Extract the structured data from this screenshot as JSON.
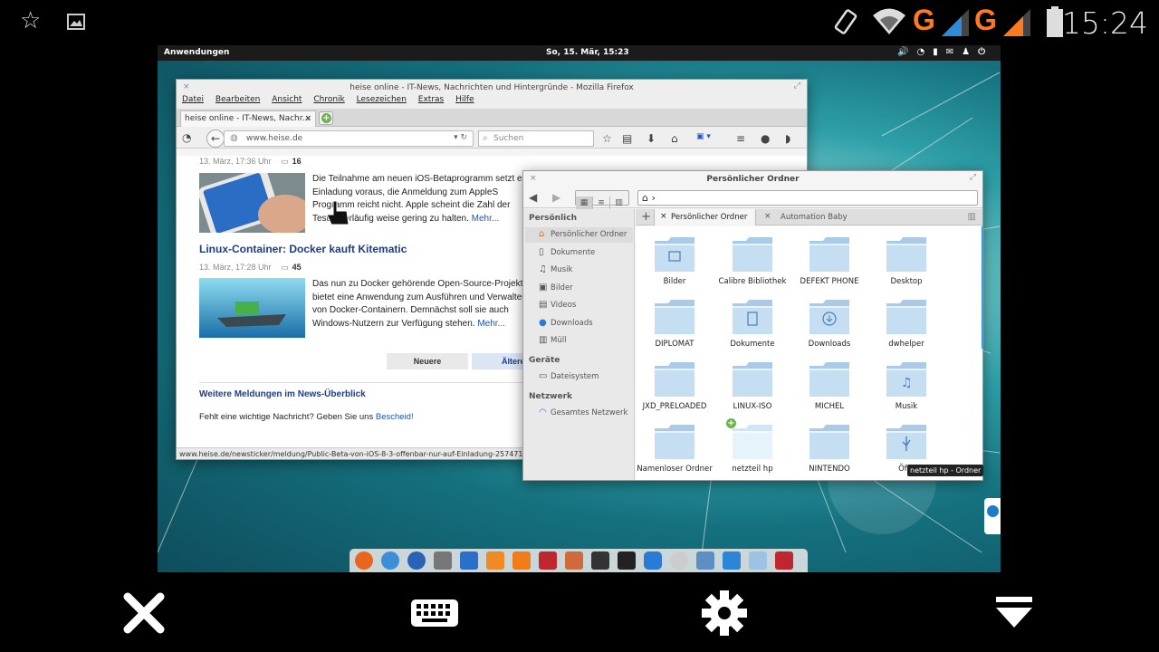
{
  "android_status": {
    "time": "15:24",
    "icons": [
      "star-icon",
      "gallery-icon",
      "rotation-icon",
      "wifi-icon",
      "signal-icon",
      "signal-icon",
      "battery-icon"
    ],
    "network_labels": [
      "G",
      "G"
    ]
  },
  "desktop_topbar": {
    "apps_label": "Anwendungen",
    "datetime": "So, 15. Mär, 15:23",
    "tray_icons": [
      "volume-icon",
      "wifi-icon",
      "battery-icon",
      "mail-icon",
      "user-icon",
      "power-icon"
    ]
  },
  "firefox": {
    "title": "heise online - IT-News, Nachrichten und Hintergründe - Mozilla Firefox",
    "menu": [
      "Datei",
      "Bearbeiten",
      "Ansicht",
      "Chronik",
      "Lesezeichen",
      "Extras",
      "Hilfe"
    ],
    "tab_label": "heise online - IT-News, Nachr...",
    "url": "www.heise.de",
    "search_placeholder": "Suchen",
    "articles": [
      {
        "meta_date": "13. März, 17:36 Uhr",
        "comments": "16",
        "text": "Die Teilnahme am neuen iOS-Betaprogramm setzt eine Einladung voraus, die Anmeldung zum AppleS Programm reicht nicht. Apple scheint die Zahl der Tester vorläufig weise gering zu halten.",
        "more": "Mehr..."
      },
      {
        "headline": "Linux-Container: Docker kauft Kitematic",
        "meta_date": "13. März, 17:28 Uhr",
        "comments": "45",
        "text": "Das nun zu Docker gehörende Open-Source-Projekt bietet eine Anwendung zum Ausführen und Verwalten von Docker-Containern. Demnächst soll sie auch Windows-Nutzern zur Verfügung stehen.",
        "more": "Mehr..."
      }
    ],
    "pager_newer": "Neuere",
    "pager_older": "Ältere",
    "more_news": "Weitere Meldungen im News-Überblick",
    "missing_text": "Fehlt eine wichtige Nachricht? Geben Sie uns",
    "missing_link": "Bescheid!",
    "status_url": "www.heise.de/newsticker/meldung/Public-Beta-von-iOS-8-3-offenbar-nur-auf-Einladung-2574710"
  },
  "files": {
    "title": "Persönlicher Ordner",
    "sidebar": {
      "section_personal": "Persönlich",
      "personal_items": [
        {
          "label": "Persönlicher Ordner",
          "icon": "home-icon"
        },
        {
          "label": "Dokumente",
          "icon": "document-icon"
        },
        {
          "label": "Musik",
          "icon": "music-icon"
        },
        {
          "label": "Bilder",
          "icon": "image-icon"
        },
        {
          "label": "Videos",
          "icon": "video-icon"
        },
        {
          "label": "Downloads",
          "icon": "download-icon"
        },
        {
          "label": "Müll",
          "icon": "trash-icon"
        }
      ],
      "section_devices": "Geräte",
      "device_items": [
        {
          "label": "Dateisystem",
          "icon": "drive-icon"
        }
      ],
      "section_network": "Netzwerk",
      "network_items": [
        {
          "label": "Gesamtes Netzwerk",
          "icon": "network-icon"
        }
      ]
    },
    "tabs": [
      "Persönlicher Ordner",
      "Automation Baby"
    ],
    "folders": [
      "Bilder",
      "Calibre Bibliothek",
      "DEFEKT PHONE",
      "Desktop",
      "DIPLOMAT",
      "Dokumente",
      "Downloads",
      "dwhelper",
      "JXD_PRELOADED",
      "LINUX-ISO",
      "MICHEL",
      "Musik",
      "Namenloser Ordner",
      "netzteil hp",
      "NINTENDO",
      "Öffe"
    ],
    "tooltip": "netzteil hp - Ordner"
  }
}
